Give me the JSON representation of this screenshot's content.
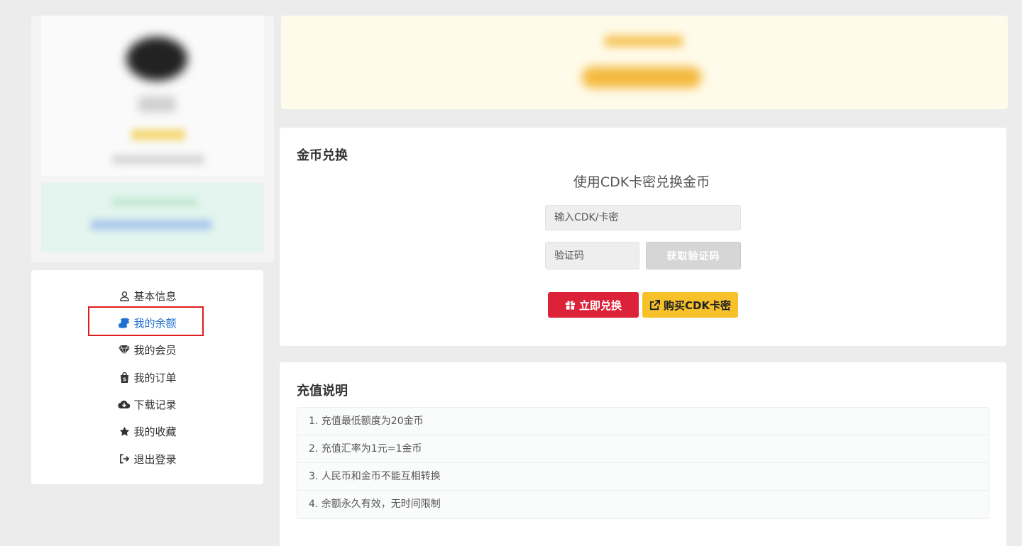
{
  "sidebar": {
    "items": [
      {
        "label": "基本信息",
        "icon": "user-icon",
        "active": false
      },
      {
        "label": "我的余额",
        "icon": "coins-icon",
        "active": true
      },
      {
        "label": "我的会员",
        "icon": "diamond-icon",
        "active": false
      },
      {
        "label": "我的订单",
        "icon": "shopping-bag-icon",
        "active": false
      },
      {
        "label": "下载记录",
        "icon": "cloud-download-icon",
        "active": false
      },
      {
        "label": "我的收藏",
        "icon": "star-icon",
        "active": false
      },
      {
        "label": "退出登录",
        "icon": "logout-icon",
        "active": false
      }
    ],
    "active_color": "#1f6fd1",
    "highlight_color": "#e11b1b"
  },
  "exchange": {
    "title": "金币兑换",
    "subtitle": "使用CDK卡密兑换金币",
    "cdk_placeholder": "输入CDK/卡密",
    "code_placeholder": "验证码",
    "get_code_label": "获取验证码",
    "redeem_label": "立即兑换",
    "buy_label": "购买CDK卡密",
    "redeem_color": "#dc2239",
    "buy_color": "#f7c12b"
  },
  "info": {
    "title": "充值说明",
    "items": [
      "1. 充值最低额度为20金币",
      "2. 充值汇率为1元=1金币",
      "3. 人民币和金币不能互相转换",
      "4. 余额永久有效，无时间限制"
    ]
  }
}
